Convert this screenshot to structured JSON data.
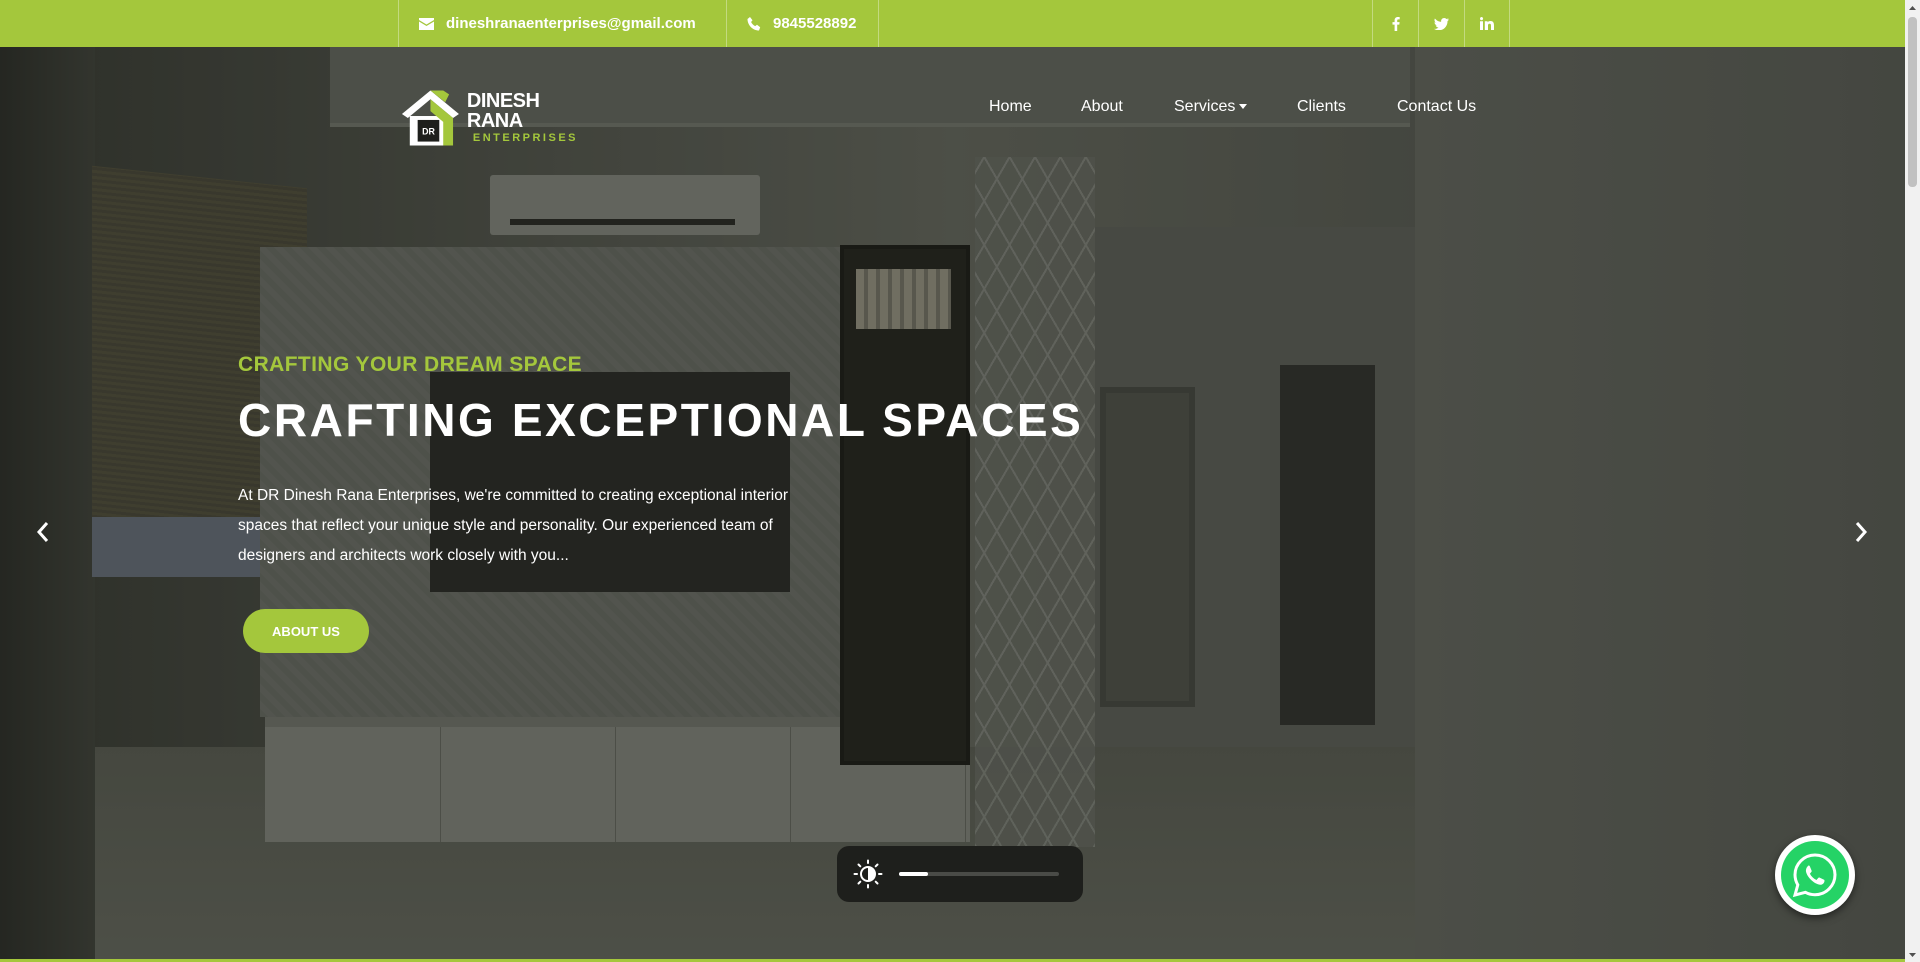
{
  "topbar": {
    "email": "dineshranaenterprises@gmail.com",
    "phone": "9845528892",
    "social": [
      "facebook-icon",
      "twitter-icon",
      "linkedin-icon"
    ]
  },
  "brand": {
    "logo_badge": "DR",
    "name_line1": "DINESH RANA",
    "name_line2": "ENTERPRISES"
  },
  "nav": {
    "items": [
      {
        "label": "Home"
      },
      {
        "label": "About"
      },
      {
        "label": "Services"
      },
      {
        "label": "Clients"
      },
      {
        "label": "Contact Us"
      }
    ]
  },
  "hero": {
    "eyebrow": "CRAFTING YOUR DREAM SPACE",
    "headline": "CRAFTING EXCEPTIONAL SPACES",
    "body": "At DR Dinesh Rana Enterprises, we're committed to creating exceptional interior spaces that reflect your unique style and personality. Our experienced team of designers and architects work closely with you...",
    "cta_label": "ABOUT US"
  },
  "brightness": {
    "icon": "brightness-icon",
    "level": 0.18
  },
  "colors": {
    "accent": "#a4c73c",
    "whatsapp": "#25d366"
  }
}
